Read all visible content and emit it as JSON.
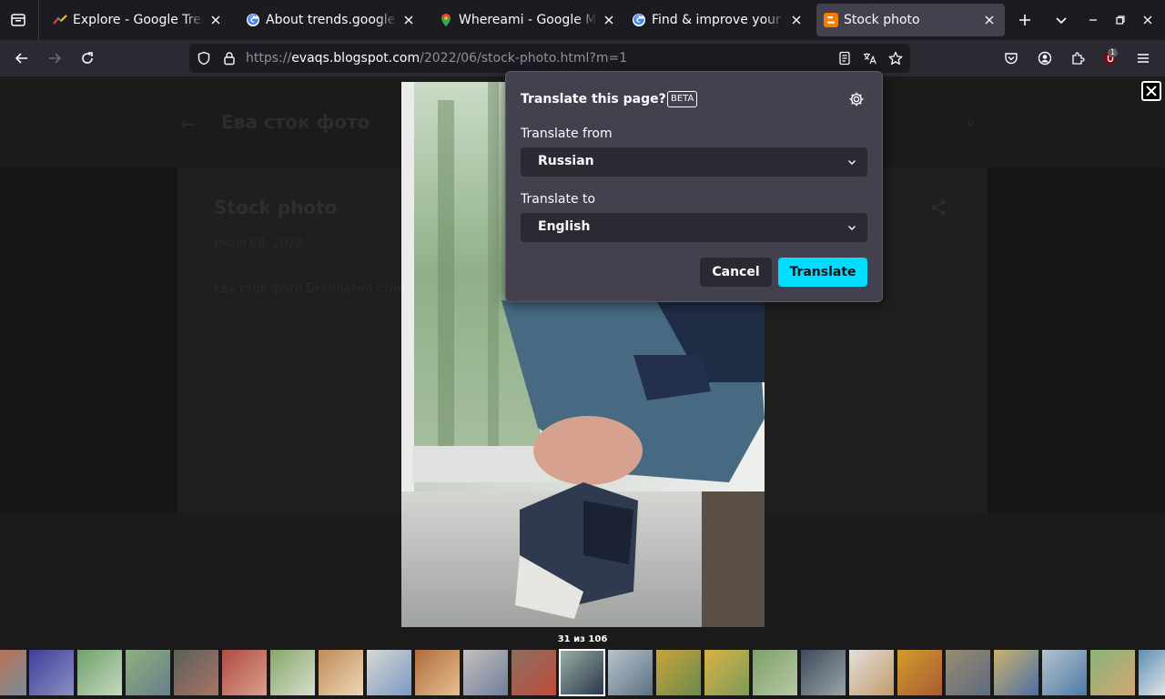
{
  "browser": {
    "tabs": [
      {
        "title": "Explore - Google Trends",
        "favicon": "trends-icon",
        "active": false
      },
      {
        "title": "About trends.google.com",
        "favicon": "google-g-icon",
        "active": false
      },
      {
        "title": "Whereami - Google Maps",
        "favicon": "maps-pin-icon",
        "active": false
      },
      {
        "title": "Find & improve your local",
        "favicon": "google-g-icon",
        "active": false
      },
      {
        "title": "Stock photo",
        "favicon": "blogger-icon",
        "active": true
      }
    ],
    "url": {
      "prefix": "https://",
      "host": "evaqs.blogspot.com",
      "path": "/2022/06/stock-photo.html?m=1"
    },
    "extension_badge": "1",
    "accent": "#00ddff"
  },
  "blog": {
    "header_title": "Ева сток фото",
    "post_title": "Stock photo",
    "post_date": "июня 08, 2022",
    "post_excerpt": "Ева сток фото Бесплатно сток фото"
  },
  "lightbox": {
    "counter": "31 из 106",
    "thumbnail_count": 25,
    "selected_thumbnail": 12
  },
  "translate_panel": {
    "title": "Translate this page?",
    "beta": "BETA",
    "from_label": "Translate from",
    "from_value": "Russian",
    "to_label": "Translate to",
    "to_value": "English",
    "cancel": "Cancel",
    "translate": "Translate"
  }
}
